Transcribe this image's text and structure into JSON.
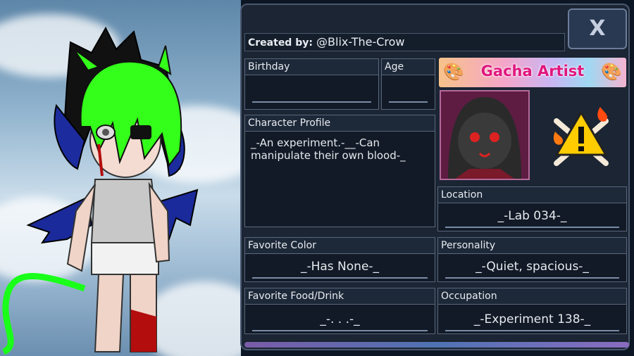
{
  "creator": {
    "label": "Created by:",
    "name": "@Blix-The-Crow"
  },
  "close_label": "X",
  "badge": {
    "title": "Gacha Artist",
    "icon": "palette-icon"
  },
  "fields": {
    "birthday": {
      "label": "Birthday",
      "value": ""
    },
    "age": {
      "label": "Age",
      "value": ""
    },
    "profile": {
      "label": "Character Profile",
      "value": "_-An experiment.-__-Can manipulate their own blood-_"
    },
    "location": {
      "label": "Location",
      "value": "_-Lab 034-_"
    },
    "favorite_color": {
      "label": "Favorite Color",
      "value": "_-Has None-_"
    },
    "personality": {
      "label": "Personality",
      "value": "_-Quiet, spacious-_"
    },
    "favorite_food": {
      "label": "Favorite Food/Drink",
      "value": "_-. . .-_"
    },
    "occupation": {
      "label": "Occupation",
      "value": "_-Experiment 138-_"
    }
  },
  "warning_icon": "warning-crossbones-icon",
  "colors": {
    "panel": "#1b2533",
    "accent_pink": "#e0177f",
    "character_hair": "#33ff1a"
  }
}
